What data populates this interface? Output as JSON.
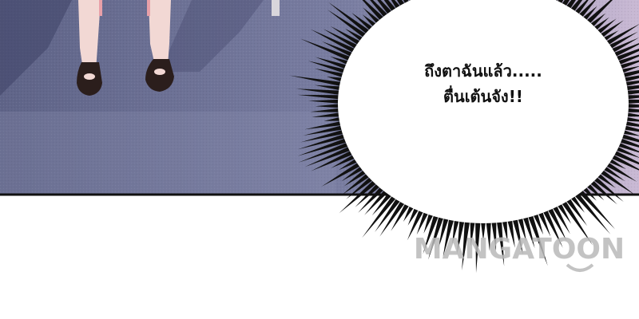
{
  "speech_bubble": {
    "lines": [
      "ถึงตาฉันแล้ว.....",
      "ตื่นเต้นจัง!!"
    ]
  },
  "watermark": {
    "text": "MANGATOON"
  },
  "colors": {
    "floor": "#6b6f93",
    "floor_light": "#9a9cbc",
    "bubble_fill": "#ffffff",
    "ink": "#111111",
    "watermark": "#b9b9b9"
  }
}
